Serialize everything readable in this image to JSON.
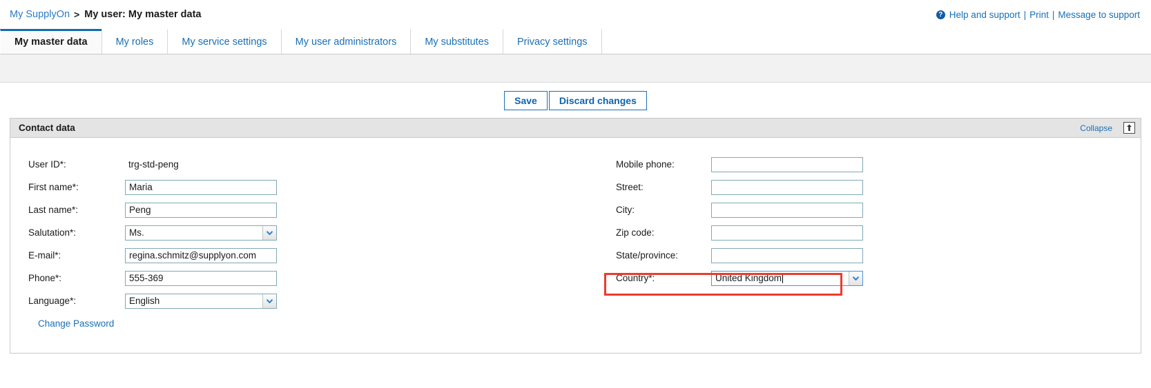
{
  "breadcrumb": {
    "root": "My SupplyOn",
    "separator": ">",
    "current": "My user: My master data"
  },
  "top_links": {
    "help_icon": "help-circle-icon",
    "help": "Help and support",
    "sep1": "|",
    "print": "Print",
    "sep2": "|",
    "message": "Message to support"
  },
  "tabs": [
    {
      "label": "My master data",
      "active": true
    },
    {
      "label": "My roles",
      "active": false
    },
    {
      "label": "My service settings",
      "active": false
    },
    {
      "label": "My user administrators",
      "active": false
    },
    {
      "label": "My substitutes",
      "active": false
    },
    {
      "label": "Privacy settings",
      "active": false
    }
  ],
  "actions": {
    "save": "Save",
    "discard": "Discard changes"
  },
  "panel": {
    "title": "Contact data",
    "collapse": "Collapse",
    "collapse_icon": "collapse-up-arrow-icon"
  },
  "form": {
    "left": [
      {
        "label": "User ID*:",
        "value": "trg-std-peng",
        "type": "static"
      },
      {
        "label": "First name*:",
        "value": "Maria",
        "type": "text"
      },
      {
        "label": "Last name*:",
        "value": "Peng",
        "type": "text"
      },
      {
        "label": "Salutation*:",
        "value": "Ms.",
        "type": "select"
      },
      {
        "label": "E-mail*:",
        "value": "regina.schmitz@supplyon.com",
        "type": "text"
      },
      {
        "label": "Phone*:",
        "value": "555-369",
        "type": "text"
      },
      {
        "label": "Language*:",
        "value": "English",
        "type": "select"
      }
    ],
    "right": [
      {
        "label": "Mobile phone:",
        "value": "",
        "type": "text"
      },
      {
        "label": "Street:",
        "value": "",
        "type": "text"
      },
      {
        "label": "City:",
        "value": "",
        "type": "text"
      },
      {
        "label": "Zip code:",
        "value": "",
        "type": "text"
      },
      {
        "label": "State/province:",
        "value": "",
        "type": "text"
      },
      {
        "label": "Country*:",
        "value": "United Kingdom",
        "type": "combo",
        "focused": true
      }
    ],
    "change_password": "Change Password"
  },
  "colors": {
    "link": "#1a6fb5",
    "accent": "#0f6bb0",
    "highlight": "#ee3a2c",
    "panel_header": "#e4e4e4",
    "input_border": "#7fa8b5"
  }
}
